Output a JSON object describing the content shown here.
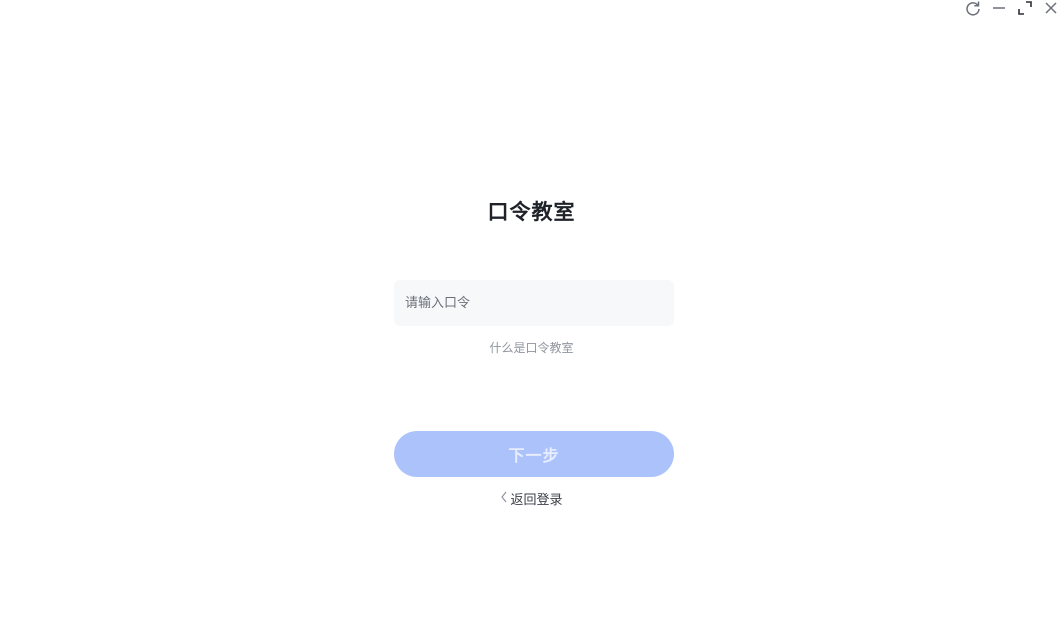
{
  "window_controls": {
    "refresh_icon": "refresh-icon",
    "minimize_icon": "minimize-icon",
    "maximize_icon": "maximize-icon",
    "close_icon": "close-icon"
  },
  "main": {
    "title": "口令教室",
    "password_input": {
      "placeholder": "请输入口令",
      "value": ""
    },
    "help_link": "什么是口令教室",
    "next_button": "下一步",
    "back_link": "返回登录",
    "back_icon": "chevron-left-icon"
  },
  "colors": {
    "primary_disabled": "#abc2fb",
    "input_bg": "#f7f8fa",
    "title": "#1f2329",
    "muted_text": "#8f959e"
  }
}
